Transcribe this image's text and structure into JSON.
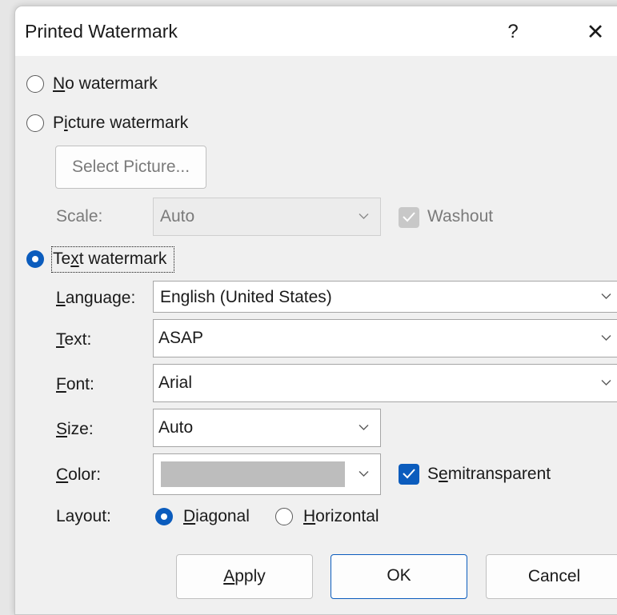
{
  "dialog": {
    "title": "Printed Watermark",
    "help_label": "?",
    "close_label": "✕"
  },
  "no_watermark": {
    "u": "N",
    "rest": "o watermark",
    "selected": false
  },
  "picture_watermark": {
    "pre": "P",
    "u": "i",
    "rest": "cture watermark",
    "selected": false,
    "select_picture_label": "Select Picture...",
    "scale_label": "Scale:",
    "scale_value": "Auto",
    "washout_label": "Washout",
    "washout_checked": true
  },
  "text_watermark": {
    "pre": "Te",
    "u": "x",
    "rest": "t watermark",
    "selected": true,
    "language": {
      "u": "L",
      "rest": "anguage:",
      "value": "English (United States)"
    },
    "text": {
      "u": "T",
      "rest": "ext:",
      "value": "ASAP"
    },
    "font": {
      "u": "F",
      "rest": "ont:",
      "value": "Arial"
    },
    "size": {
      "u": "S",
      "rest": "ize:",
      "value": "Auto"
    },
    "color": {
      "u": "C",
      "rest": "olor:",
      "swatch": "#bdbdbd"
    },
    "semitransparent": {
      "pre": "S",
      "u": "e",
      "rest": "mitransparent",
      "checked": true
    },
    "layout": {
      "label": "Layout:",
      "diagonal": {
        "u": "D",
        "rest": "iagonal",
        "selected": true
      },
      "horizontal": {
        "u": "H",
        "rest": "orizontal",
        "selected": false
      }
    }
  },
  "buttons": {
    "apply": {
      "u": "A",
      "rest": "pply"
    },
    "ok": "OK",
    "cancel": "Cancel"
  },
  "colors": {
    "accent": "#0b5cbd",
    "disabled_text": "#7a7a7a"
  }
}
